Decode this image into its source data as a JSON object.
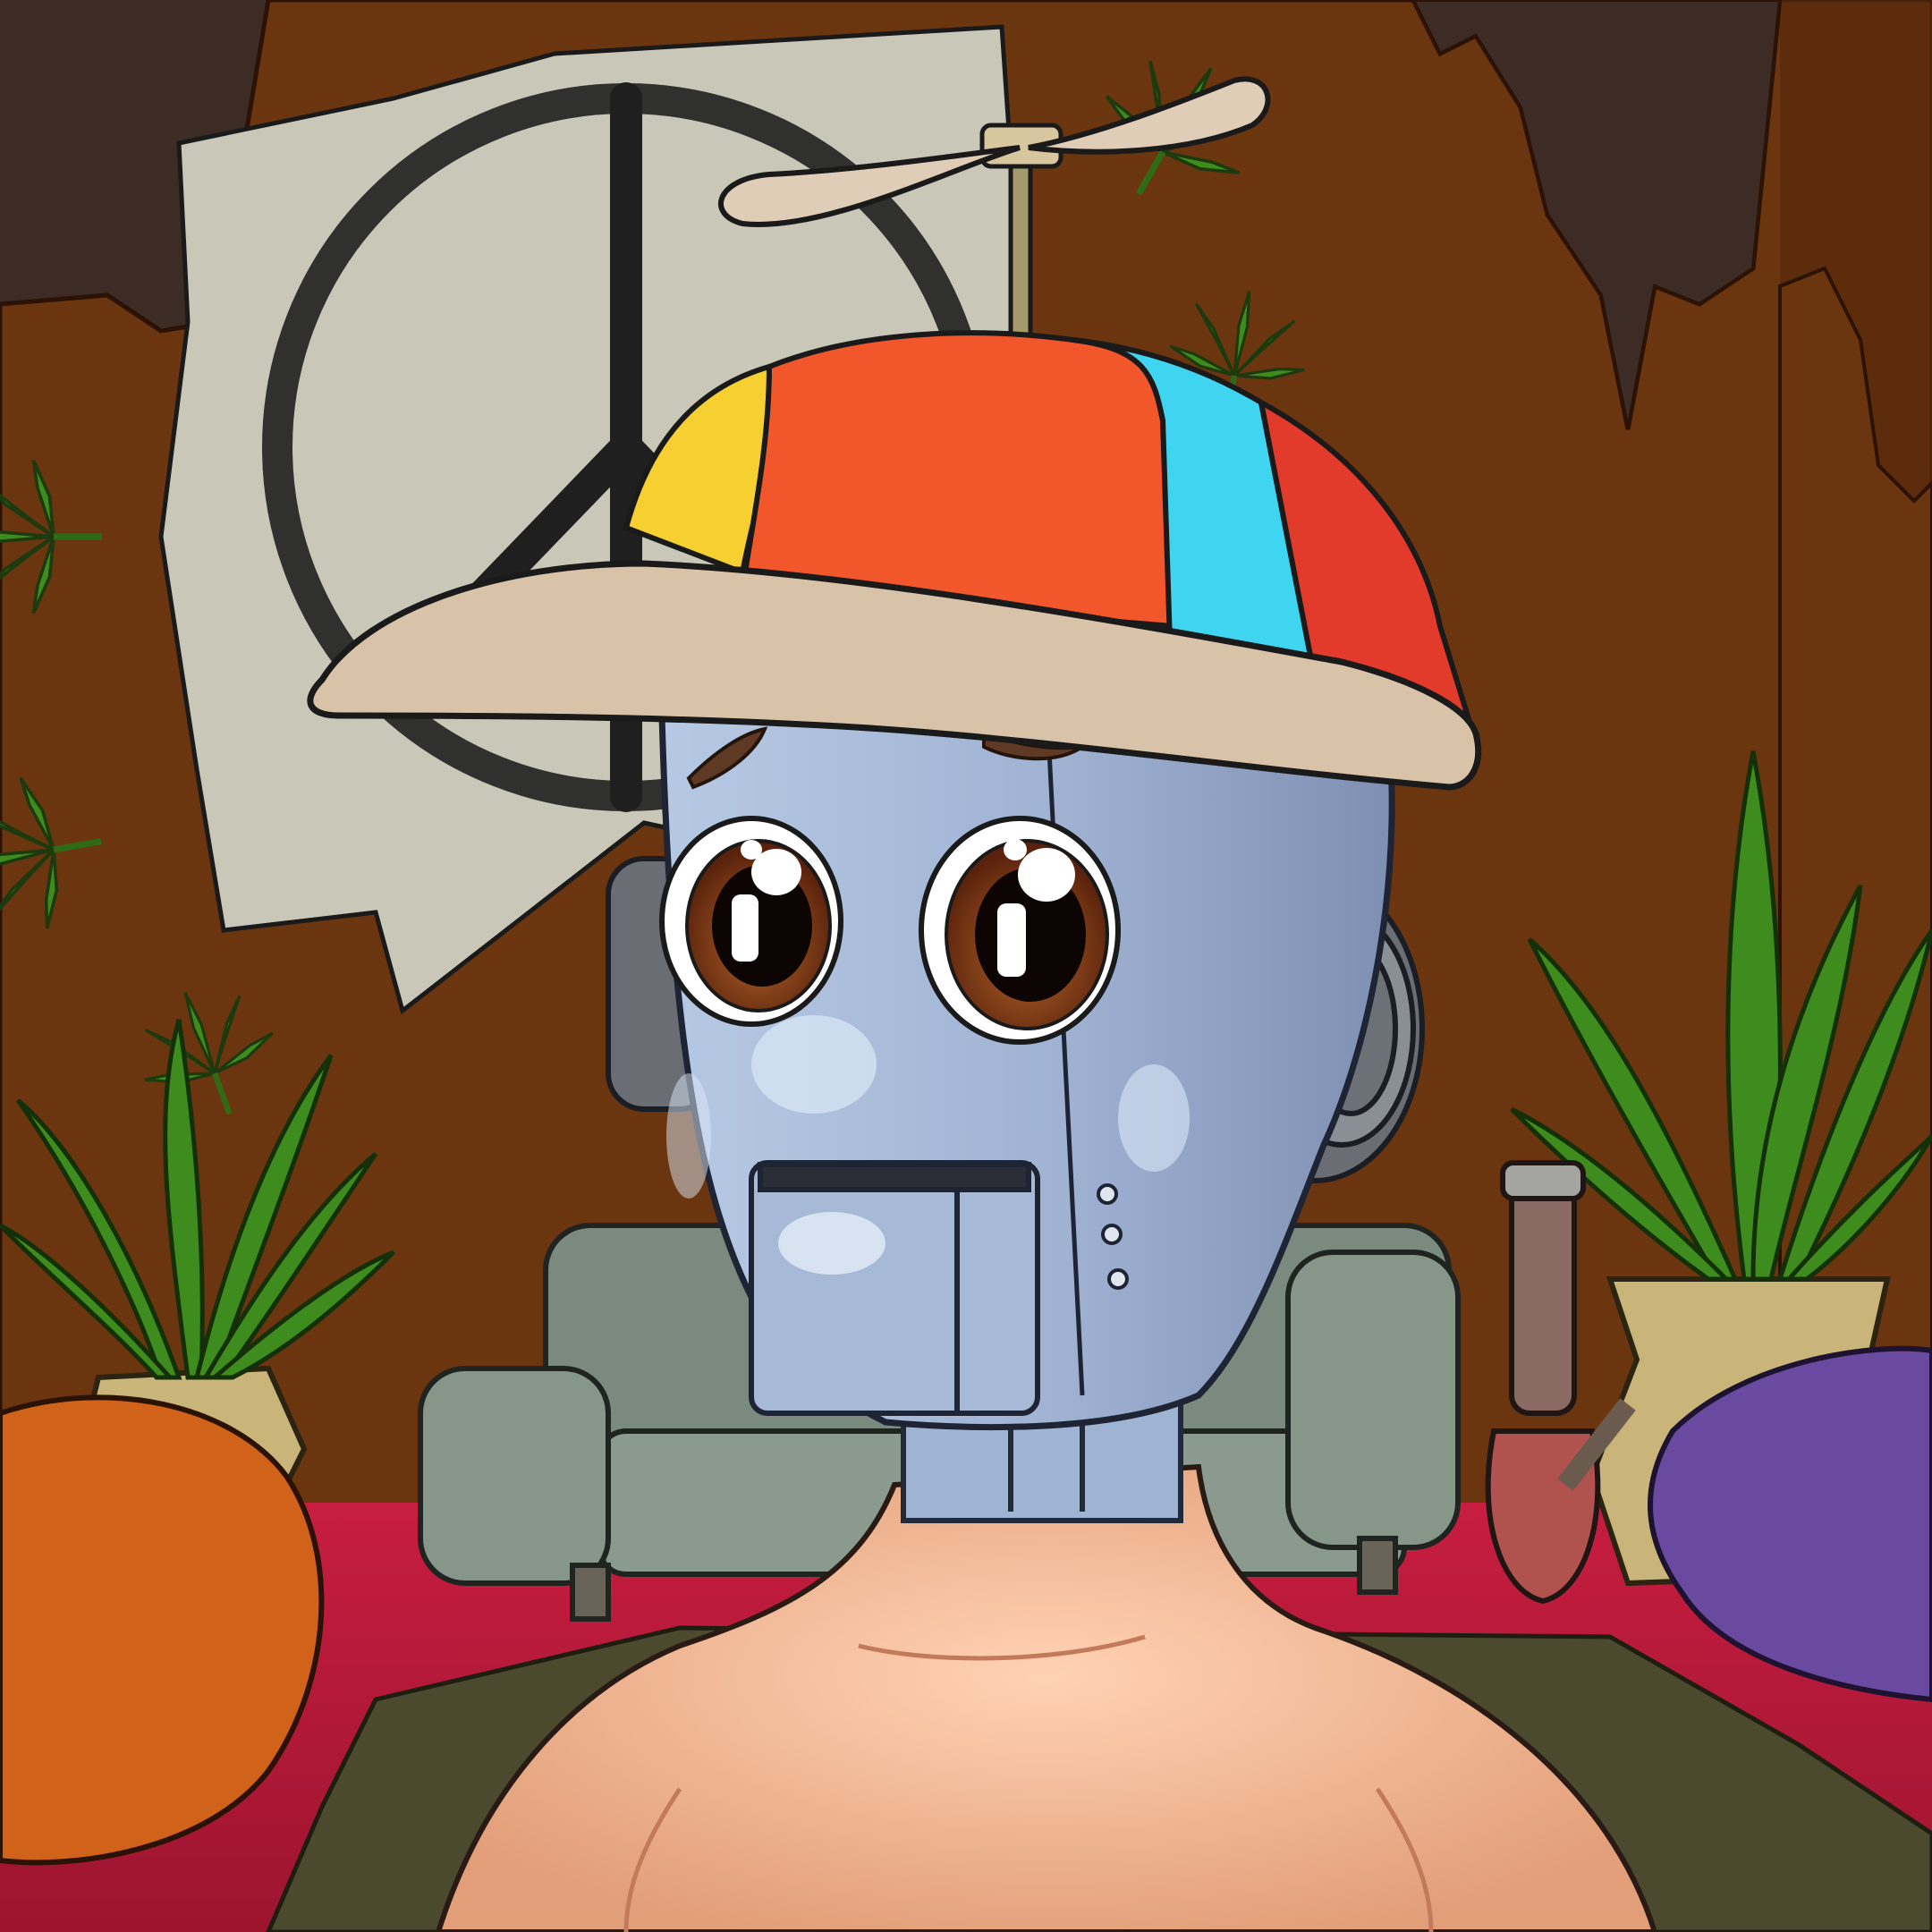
{
  "image": {
    "kind": "cartoon-illustration",
    "subject": "robot-character",
    "visible_text": []
  },
  "palette": {
    "wall": "#6b3510",
    "wall_dark": "#4a2308",
    "outer_wall": "#3c2c25",
    "floor": "#c11f3c",
    "rug": "#4c4a2e",
    "poster": "#c8c7b8",
    "peace_ink": "#1f1f1f",
    "robot_head": "#a3b8d4",
    "robot_head_shade": "#7d8fb1",
    "skin": "#f0b592",
    "cap_orange": "#f2572c",
    "cap_yellow": "#f6d030",
    "cap_cyan": "#3fd4f0",
    "cap_red": "#e33b2b",
    "cap_brim": "#d8c2a8",
    "propeller": "#e0cdb8",
    "couch": "#7a8a7e",
    "leaf": "#3f8c1e",
    "pot": "#c9b47a",
    "beanbag_orange": "#d0621a",
    "beanbag_purple": "#6a4aa0",
    "bong_glass": "#8a6a62",
    "eye_iris": "#6b2f14"
  },
  "icons": {
    "hat": "propeller-beanie-icon",
    "poster": "peace-sign-icon",
    "leaves": "cannabis-leaf-icon"
  }
}
